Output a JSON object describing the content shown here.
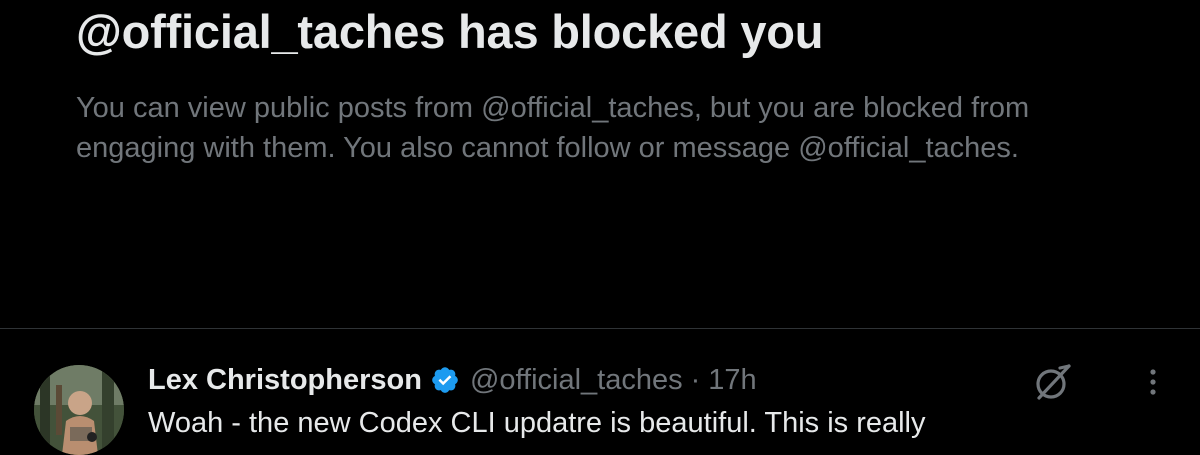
{
  "blocked_notice": {
    "title": "@official_taches has blocked you",
    "description": "You can view public posts from @official_taches, but you are blocked from engaging with them. You also cannot follow or message @official_taches."
  },
  "post": {
    "author_name": "Lex Christopherson",
    "handle": "@official_taches",
    "separator": "·",
    "time": "17h",
    "text": "Woah - the new Codex CLI updatre is beautiful. This is really",
    "verified": true,
    "icons": {
      "verified": "verified-badge-icon",
      "grok": "grok-icon",
      "more": "more-options-icon"
    }
  },
  "colors": {
    "background": "#000000",
    "primary_text": "#e7e9ea",
    "secondary_text": "#71767b",
    "divider": "#2f3336",
    "verified_blue": "#1d9bf0"
  }
}
